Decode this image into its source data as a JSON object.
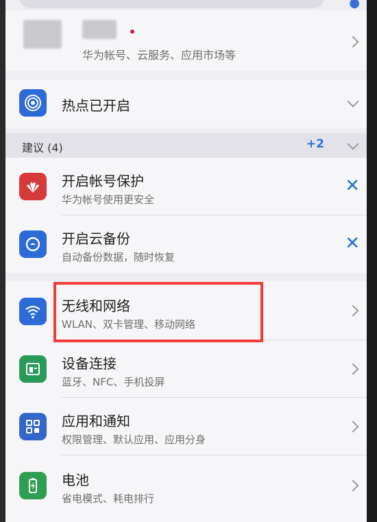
{
  "account": {
    "subtitle": "华为帐号、云服务、应用市场等"
  },
  "hotspot": {
    "title": "热点已开启"
  },
  "suggestions": {
    "header": "建议 (4)",
    "more": "+2",
    "items": [
      {
        "title": "开启帐号保护",
        "subtitle": "华为帐号使用更安全"
      },
      {
        "title": "开启云备份",
        "subtitle": "自动备份数据，随时恢复"
      }
    ]
  },
  "settings": [
    {
      "title": "无线和网络",
      "subtitle": "WLAN、双卡管理、移动网络"
    },
    {
      "title": "设备连接",
      "subtitle": "蓝牙、NFC、手机投屏"
    },
    {
      "title": "应用和通知",
      "subtitle": "权限管理、默认应用、应用分身"
    },
    {
      "title": "电池",
      "subtitle": "省电模式、耗电排行"
    }
  ],
  "colors": {
    "accent": "#2f6ed6",
    "highlight": "#ef3b3b",
    "huawei_red": "#d63a3a",
    "wifi_blue": "#2c6ad8",
    "device_green": "#2a9a5a",
    "apps_blue": "#3465c8",
    "battery_green": "#2e9e52"
  },
  "icons": {
    "hotspot": "hotspot-icon",
    "huawei": "huawei-logo-icon",
    "cloud_backup": "cloud-backup-icon",
    "wireless": "wifi-icon",
    "device_connect": "device-connect-icon",
    "apps": "apps-grid-icon",
    "battery": "battery-icon"
  }
}
